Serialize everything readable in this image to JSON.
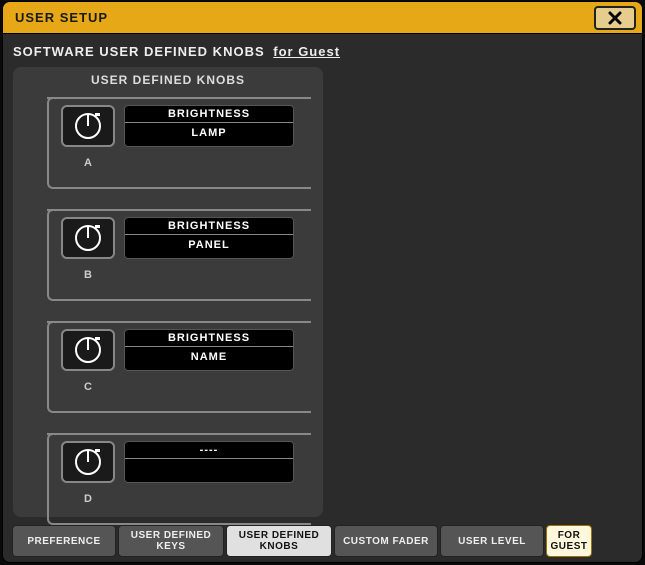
{
  "window": {
    "title": "USER SETUP"
  },
  "subtitle": {
    "main": "SOFTWARE USER DEFINED KNOBS",
    "suffix": "for Guest"
  },
  "panel": {
    "title": "USER DEFINED KNOBS"
  },
  "knobs": [
    {
      "letter": "A",
      "line1": "BRIGHTNESS",
      "line2": "LAMP"
    },
    {
      "letter": "B",
      "line1": "BRIGHTNESS",
      "line2": "PANEL"
    },
    {
      "letter": "C",
      "line1": "BRIGHTNESS",
      "line2": "NAME"
    },
    {
      "letter": "D",
      "line1": "----",
      "line2": ""
    }
  ],
  "tabs": {
    "preference": "PREFERENCE",
    "user_keys": "USER DEFINED\nKEYS",
    "user_knobs": "USER DEFINED\nKNOBS",
    "custom_fader": "CUSTOM FADER",
    "user_level": "USER LEVEL",
    "for_guest": "FOR\nGUEST"
  }
}
